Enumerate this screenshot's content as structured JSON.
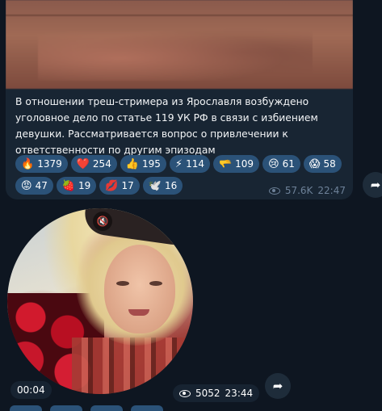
{
  "post": {
    "caption": "В отношении треш-стримера из Ярославля возбуждено уголовное дело по статье 119 УК РФ в связи с избиением девушки. Рассматривается вопрос о привлечении к ответственности по другим эпизодам",
    "reactions_row1": [
      {
        "emoji": "🔥",
        "count": "1379"
      },
      {
        "emoji": "❤️",
        "count": "254"
      },
      {
        "emoji": "👍",
        "count": "195"
      },
      {
        "emoji": "⚡",
        "count": "114"
      },
      {
        "emoji": "🫳",
        "count": "109"
      },
      {
        "emoji": "😢",
        "count": "61"
      },
      {
        "emoji": "😱",
        "count": "58"
      }
    ],
    "reactions_row2": [
      {
        "emoji": "😡",
        "count": "47"
      },
      {
        "emoji": "🍓",
        "count": "19"
      },
      {
        "emoji": "💋",
        "count": "17"
      },
      {
        "emoji": "🕊️",
        "count": "16"
      }
    ],
    "views": "57.6K",
    "time": "22:47"
  },
  "video_note": {
    "duration": "00:04",
    "views": "5052",
    "time": "23:44",
    "mute_icon": "🔇"
  },
  "forward_icon": "➦"
}
